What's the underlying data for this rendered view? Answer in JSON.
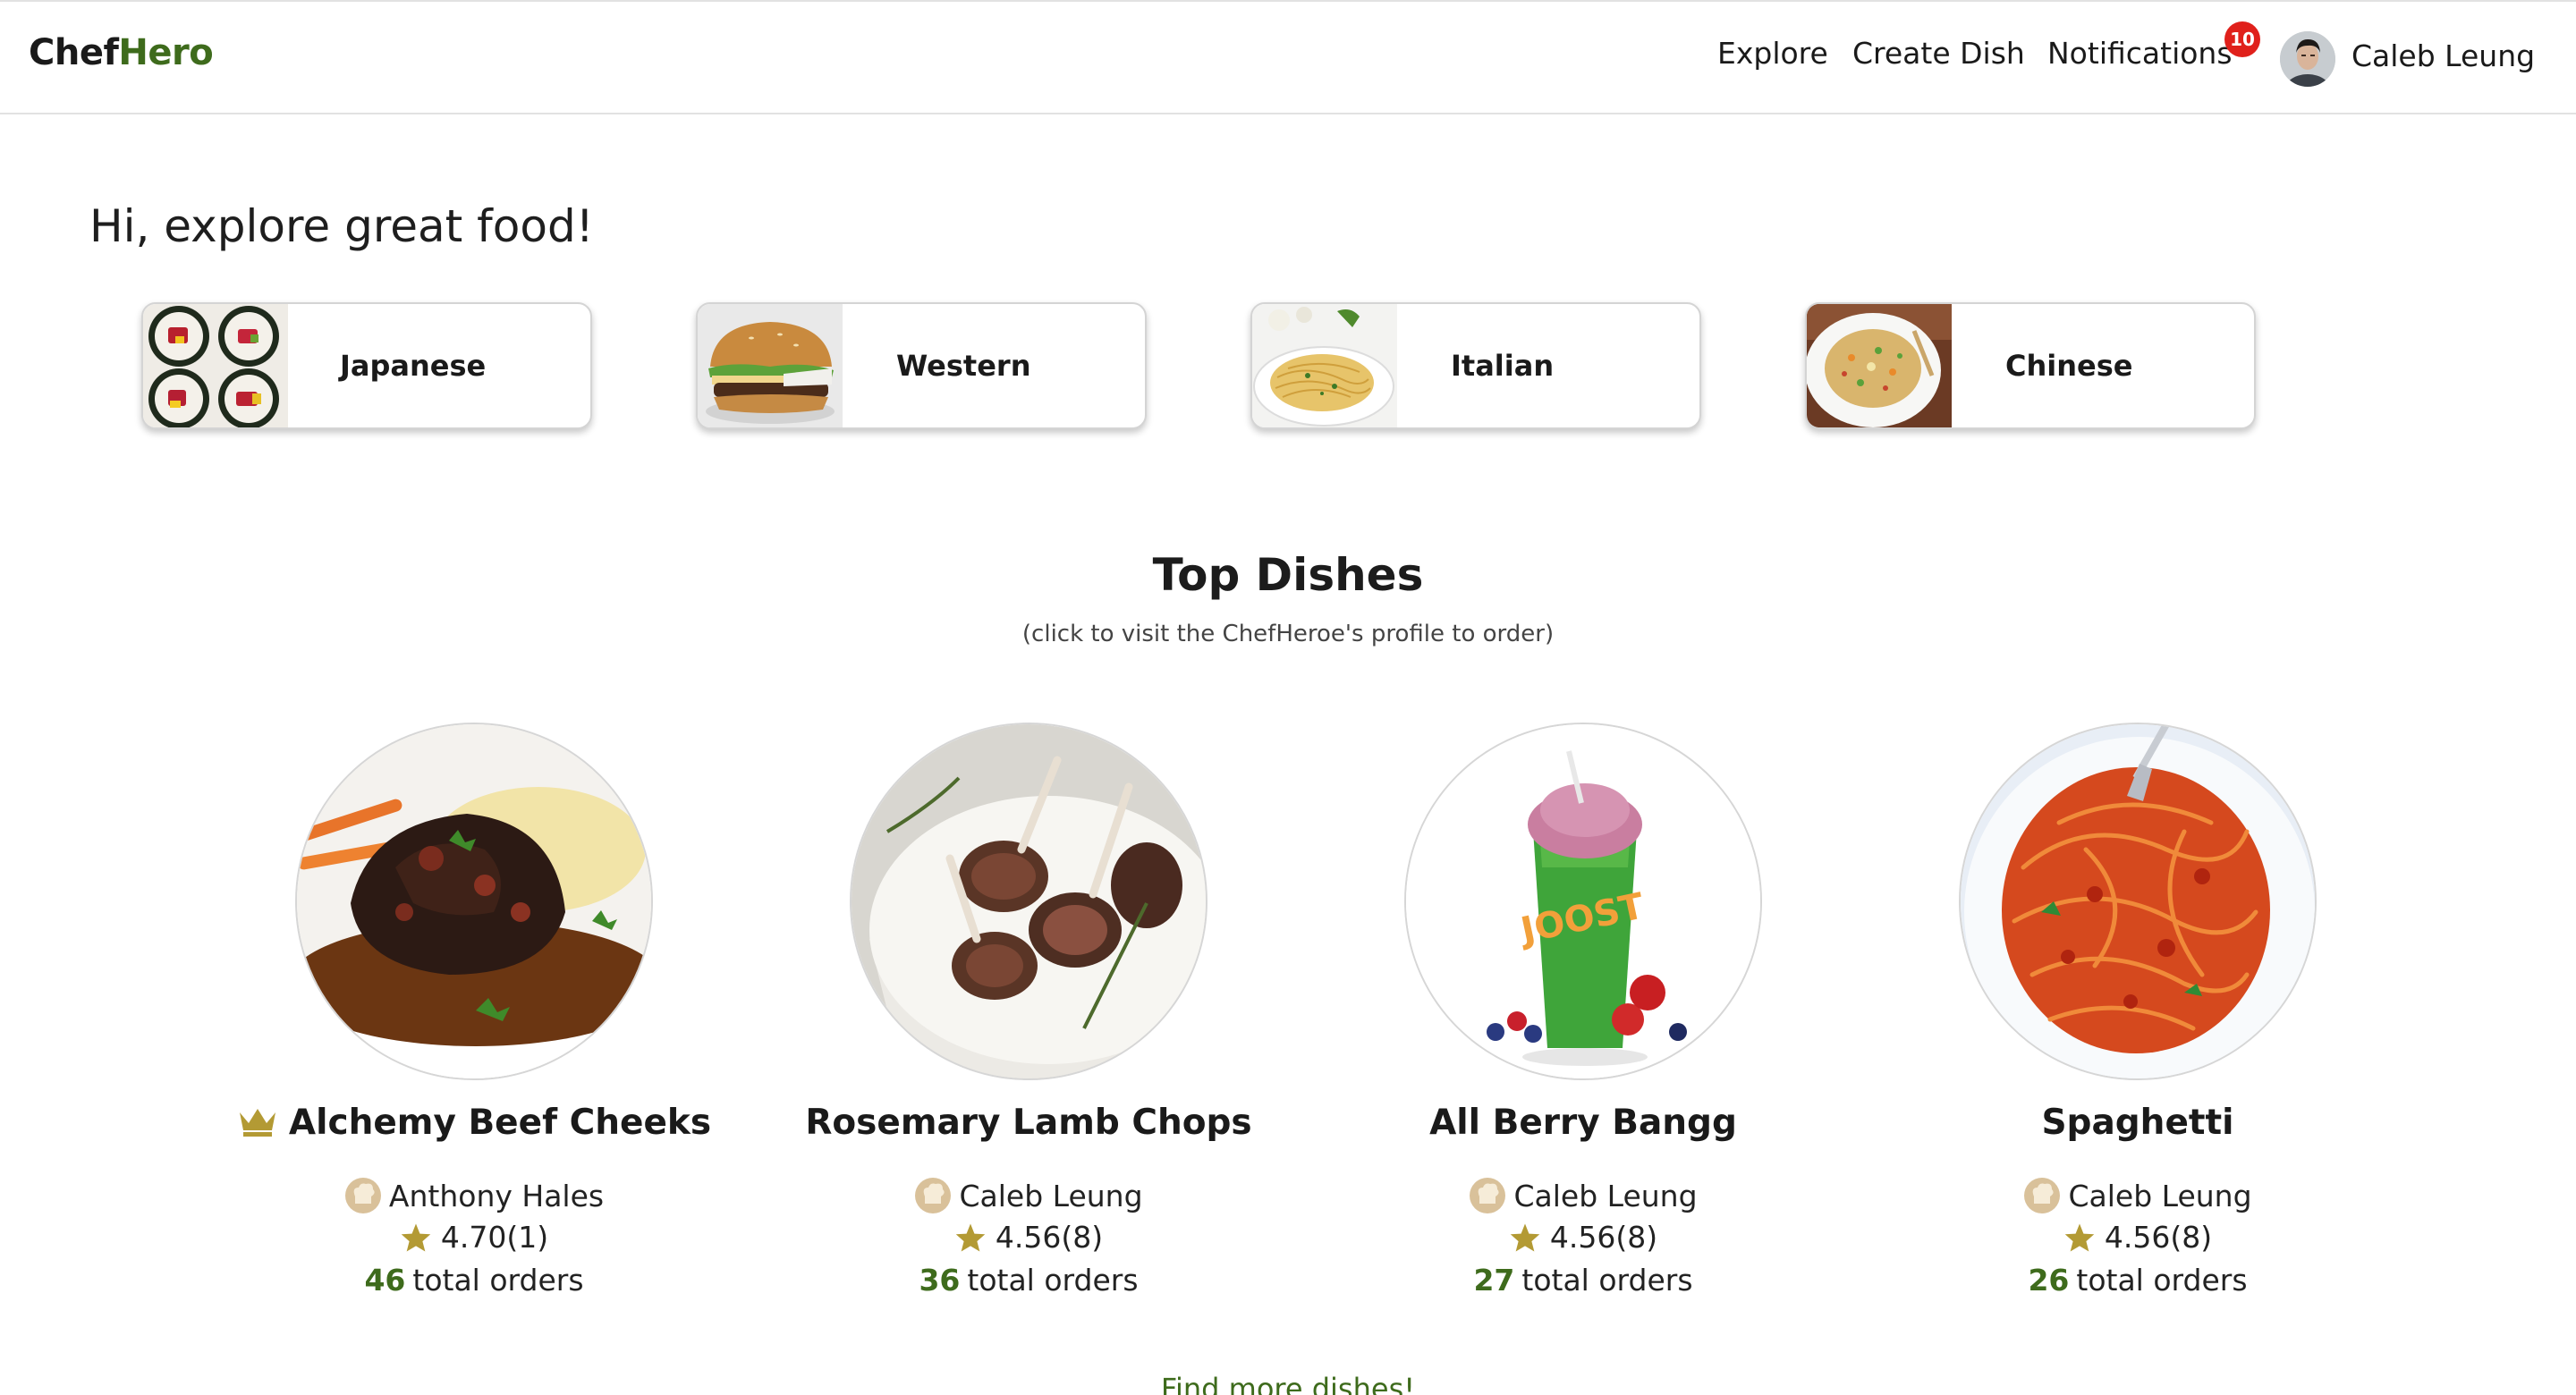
{
  "app": {
    "logo_part1": "Chef",
    "logo_part2": "Hero"
  },
  "header": {
    "nav": {
      "explore": "Explore",
      "create_dish": "Create Dish",
      "notifications": "Notifications"
    },
    "notification_count": "10",
    "user_name": "Caleb Leung"
  },
  "greeting": "Hi, explore great food!",
  "categories": [
    {
      "label": "Japanese",
      "icon": "sushi-photo"
    },
    {
      "label": "Western",
      "icon": "burger-photo"
    },
    {
      "label": "Italian",
      "icon": "pasta-photo"
    },
    {
      "label": "Chinese",
      "icon": "fried-rice-photo"
    }
  ],
  "top_dishes": {
    "title": "Top Dishes",
    "subtitle": "(click to visit the ChefHeroe's profile to order)",
    "items": [
      {
        "name": "Alchemy Beef Cheeks",
        "chef": "Anthony Hales",
        "rating": "4.70(1)",
        "orders_count": "46",
        "orders_label": "total orders",
        "top_ranked": true
      },
      {
        "name": "Rosemary Lamb Chops",
        "chef": "Caleb Leung",
        "rating": "4.56(8)",
        "orders_count": "36",
        "orders_label": "total orders"
      },
      {
        "name": "All Berry Bangg",
        "chef": "Caleb Leung",
        "rating": "4.56(8)",
        "orders_count": "27",
        "orders_label": "total orders"
      },
      {
        "name": "Spaghetti",
        "chef": "Caleb Leung",
        "rating": "4.56(8)",
        "orders_count": "26",
        "orders_label": "total orders"
      }
    ]
  },
  "more_link": "Find more dishes!",
  "colors": {
    "brand_green": "#3e6b1c",
    "gold": "#b39a34",
    "badge_red": "#e0201b"
  }
}
